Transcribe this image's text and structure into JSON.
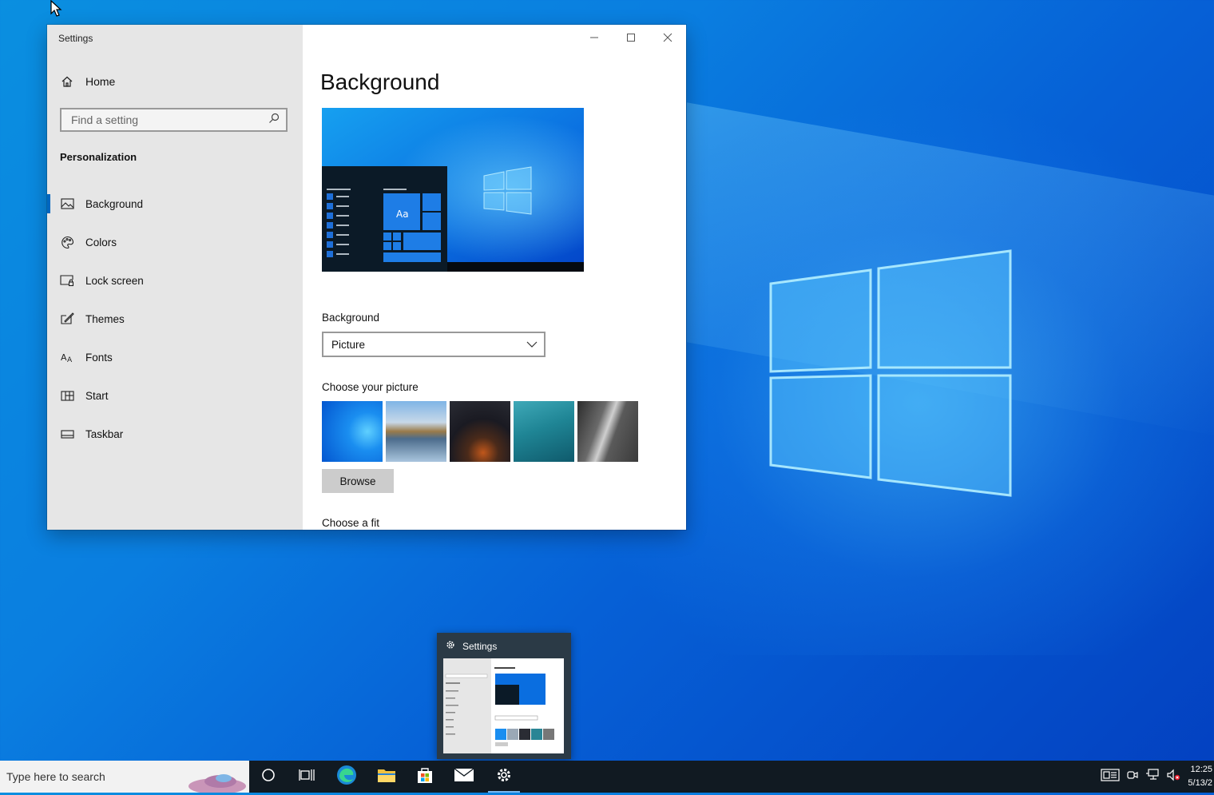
{
  "window": {
    "title": "Settings",
    "caption": {
      "minimize": "—",
      "maximize": "☐",
      "close": "✕"
    }
  },
  "sidebar": {
    "home_label": "Home",
    "search_placeholder": "Find a setting",
    "section_heading": "Personalization",
    "items": [
      {
        "label": "Background",
        "icon": "picture-icon",
        "active": true
      },
      {
        "label": "Colors",
        "icon": "palette-icon",
        "active": false
      },
      {
        "label": "Lock screen",
        "icon": "lock-screen-icon",
        "active": false
      },
      {
        "label": "Themes",
        "icon": "brush-icon",
        "active": false
      },
      {
        "label": "Fonts",
        "icon": "font-icon",
        "active": false
      },
      {
        "label": "Start",
        "icon": "start-icon",
        "active": false
      },
      {
        "label": "Taskbar",
        "icon": "taskbar-icon",
        "active": false
      }
    ]
  },
  "content": {
    "page_title": "Background",
    "preview_tile_text": "Aa",
    "background_label": "Background",
    "background_value": "Picture",
    "choose_picture_label": "Choose your picture",
    "browse_label": "Browse",
    "choose_fit_label": "Choose a fit"
  },
  "taskbar_preview": {
    "title": "Settings"
  },
  "taskbar": {
    "search_placeholder": "Type here to search",
    "clock_time": "12:25",
    "clock_date": "5/13/2"
  },
  "colors": {
    "accent": "#0067c0",
    "desktop": "#0a7ee0",
    "taskbar": "#111a22",
    "sidebar": "#e6e6e6"
  }
}
